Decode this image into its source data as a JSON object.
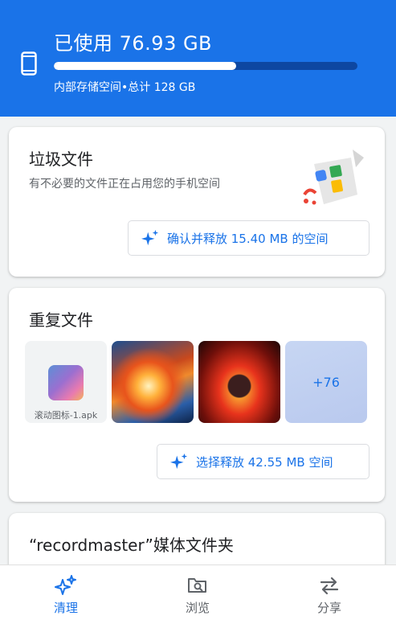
{
  "storage": {
    "used_title": "已使用 76.93 GB",
    "subtitle": "内部存储空间•总计 128 GB",
    "used_fraction": 0.601
  },
  "junk": {
    "title": "垃圾文件",
    "description": "有不必要的文件正在占用您的手机空间",
    "action_label": "确认并释放 15.40 MB 的空间"
  },
  "duplicates": {
    "title": "重复文件",
    "apk_label": "滚动图标-1.apk",
    "more_count": "+76",
    "action_label": "选择释放 42.55 MB 空间"
  },
  "media_folder": {
    "title": "“recordmaster”媒体文件夹"
  },
  "nav": {
    "items": [
      {
        "label": "清理",
        "icon": "sparkle-icon",
        "active": true
      },
      {
        "label": "浏览",
        "icon": "folder-search-icon",
        "active": false
      },
      {
        "label": "分享",
        "icon": "swap-arrows-icon",
        "active": false
      }
    ]
  },
  "colors": {
    "accent": "#1a73e8",
    "header_bg": "#1a73e8",
    "bar_track": "#0d47a1"
  }
}
